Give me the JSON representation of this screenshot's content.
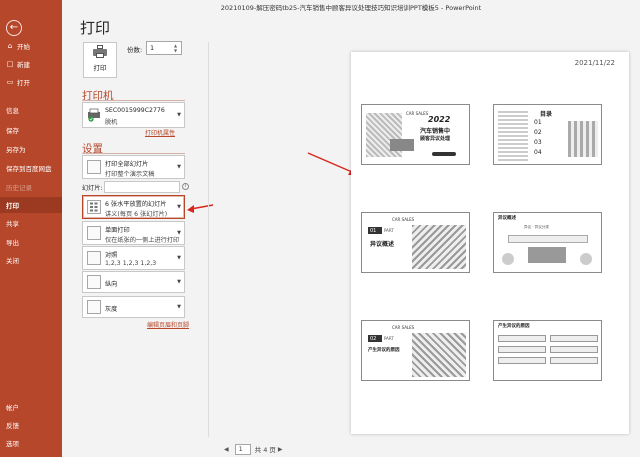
{
  "window": {
    "title": "20210109-解压密码tb25-汽车销售中顾客异议处理技巧知识培训PPT模板5  -  PowerPoint"
  },
  "page_title": "打印",
  "sidebar": {
    "items": [
      {
        "label": "开始",
        "icon": "home-icon"
      },
      {
        "label": "新建",
        "icon": "new-icon"
      },
      {
        "label": "打开",
        "icon": "open-folder-icon"
      },
      {
        "label": "信息"
      },
      {
        "label": "保存"
      },
      {
        "label": "另存为"
      },
      {
        "label": "保存到百度网盘"
      },
      {
        "label": "历史记录"
      },
      {
        "label": "打印"
      },
      {
        "label": "共享"
      },
      {
        "label": "导出"
      },
      {
        "label": "关闭"
      }
    ],
    "bottom": [
      {
        "label": "帐户"
      },
      {
        "label": "反馈"
      },
      {
        "label": "选项"
      }
    ]
  },
  "print": {
    "button_label": "打印",
    "copies_label": "份数:",
    "copies_value": "1"
  },
  "printer": {
    "heading": "打印机",
    "name": "SEC0015999C2776",
    "status": "脱机",
    "properties_link": "打印机属性"
  },
  "settings": {
    "heading": "设置",
    "range": {
      "line1": "打印全部幻灯片",
      "line2": "打印整个演示文稿"
    },
    "slides_label": "幻灯片:",
    "layout": {
      "line1": "6 张水平放置的幻灯片",
      "line2": "讲义(每页 6 张幻灯片)"
    },
    "sides": {
      "line1": "单面打印",
      "line2": "仅在纸张的一侧上进行打印"
    },
    "collate": {
      "line1": "对照",
      "line2": "1,2,3     1,2,3     1,2,3"
    },
    "orientation": {
      "line1": "纵向"
    },
    "color": {
      "line1": "灰度"
    },
    "edit_header_link": "编辑页眉和页脚"
  },
  "preview": {
    "date": "2021/11/22",
    "slides": [
      {
        "year": "2022",
        "title": "汽车销售中",
        "subtitle": "顾客异议处理",
        "tag": "CAR SALES"
      },
      {
        "title": "目录",
        "items": [
          "01",
          "02",
          "03",
          "04"
        ]
      },
      {
        "tag": "CAR SALES",
        "number": "01",
        "part": "PART",
        "title": "异议概述"
      },
      {
        "title": "异议概述",
        "subtitle": "异议 · 异议分类"
      },
      {
        "tag": "CAR SALES",
        "number": "02",
        "part": "PART",
        "title": "产生异议的原因"
      },
      {
        "title": "产生异议的原因"
      }
    ]
  },
  "pager": {
    "current": "1",
    "total": "共 4 页"
  }
}
